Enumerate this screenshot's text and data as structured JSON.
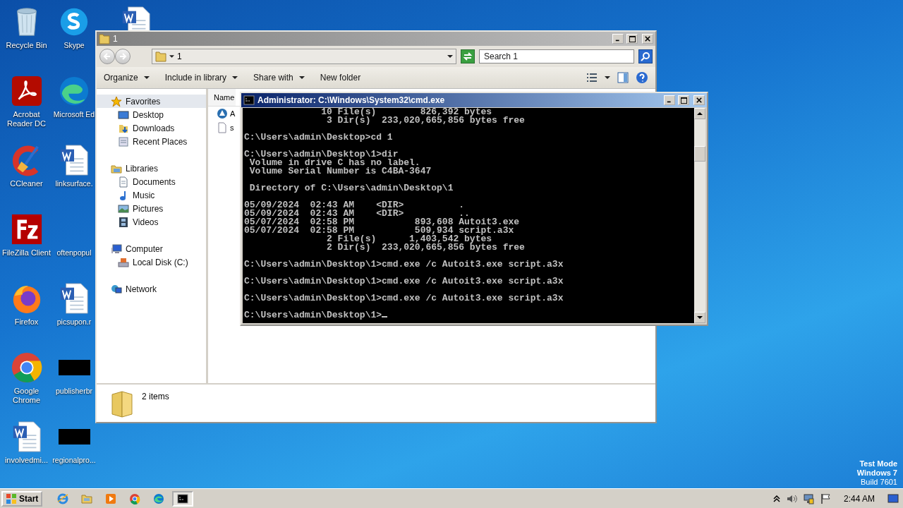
{
  "desktop": {
    "columns": [
      [
        {
          "label": "Recycle Bin",
          "kind": "recycle"
        },
        {
          "label": "Acrobat Reader DC",
          "kind": "acrobat"
        },
        {
          "label": "CCleaner",
          "kind": "ccleaner"
        },
        {
          "label": "FileZilla Client",
          "kind": "filezilla"
        },
        {
          "label": "Firefox",
          "kind": "firefox"
        },
        {
          "label": "Google Chrome",
          "kind": "chrome"
        },
        {
          "label": "involvedmi...",
          "kind": "word"
        }
      ],
      [
        {
          "label": "Skype",
          "kind": "skype"
        },
        {
          "label": "Microsoft Ed",
          "kind": "edge"
        },
        {
          "label": "linksurface.",
          "kind": "word"
        },
        {
          "label": "oftenpopul",
          "kind": "none"
        },
        {
          "label": "picsupon.r",
          "kind": "word"
        },
        {
          "label": "publisherbr",
          "kind": "blank"
        },
        {
          "label": "regionalpro...",
          "kind": "blank"
        }
      ],
      [
        {
          "kind": "word"
        }
      ]
    ],
    "os_notice": [
      "Test Mode",
      "Windows 7",
      "Build 7601"
    ]
  },
  "explorer": {
    "title": "1",
    "address": "1",
    "search": {
      "placeholder": "Search 1"
    },
    "toolbar": [
      {
        "label": "Organize",
        "dropdown": true
      },
      {
        "label": "Include in library",
        "dropdown": true
      },
      {
        "label": "Share with",
        "dropdown": true
      },
      {
        "label": "New folder",
        "dropdown": false
      }
    ],
    "nav": [
      {
        "label": "Favorites",
        "kind": "star",
        "selected": true,
        "children": [
          {
            "label": "Desktop",
            "kind": "desktop",
            "selected": false
          },
          {
            "label": "Downloads",
            "kind": "downloads",
            "selected": false
          },
          {
            "label": "Recent Places",
            "kind": "recent",
            "selected": false
          }
        ]
      },
      {
        "label": "Libraries",
        "kind": "libraries",
        "selected": false,
        "children": [
          {
            "label": "Documents",
            "kind": "documents",
            "selected": false
          },
          {
            "label": "Music",
            "kind": "music",
            "selected": false
          },
          {
            "label": "Pictures",
            "kind": "pictures",
            "selected": false
          },
          {
            "label": "Videos",
            "kind": "videos",
            "selected": false
          }
        ]
      },
      {
        "label": "Computer",
        "kind": "computer",
        "selected": false,
        "children": [
          {
            "label": "Local Disk (C:)",
            "kind": "disk",
            "selected": false
          }
        ]
      },
      {
        "label": "Network",
        "kind": "network",
        "selected": false
      }
    ],
    "columns": [
      "Name"
    ],
    "files": [
      {
        "name": "A",
        "kind": "autoit"
      },
      {
        "name": "s",
        "kind": "file"
      }
    ],
    "status": "2 items"
  },
  "cmd": {
    "title": "Administrator: C:\\Windows\\System32\\cmd.exe",
    "blocks": [
      [
        "              10 File(s)        826,392 bytes",
        "               3 Dir(s)  233,020,665,856 bytes free"
      ],
      [
        "C:\\Users\\admin\\Desktop>cd 1"
      ],
      [
        "C:\\Users\\admin\\Desktop\\1>dir",
        " Volume in drive C has no label.",
        " Volume Serial Number is C4BA-3647"
      ],
      [
        " Directory of C:\\Users\\admin\\Desktop\\1"
      ],
      [
        "05/09/2024  02:43 AM    <DIR>          .",
        "05/09/2024  02:43 AM    <DIR>          ..",
        "05/07/2024  02:58 PM           893,608 Autoit3.exe",
        "05/07/2024  02:58 PM           509,934 script.a3x",
        "               2 File(s)      1,403,542 bytes",
        "               2 Dir(s)  233,020,665,856 bytes free"
      ],
      [
        "C:\\Users\\admin\\Desktop\\1>cmd.exe /c Autoit3.exe script.a3x"
      ],
      [
        "C:\\Users\\admin\\Desktop\\1>cmd.exe /c Autoit3.exe script.a3x"
      ],
      [
        "C:\\Users\\admin\\Desktop\\1>cmd.exe /c Autoit3.exe script.a3x"
      ],
      [
        "C:\\Users\\admin\\Desktop\\1>"
      ]
    ]
  },
  "taskbar": {
    "start": "Start",
    "apps": [
      {
        "kind": "ie",
        "selected": false
      },
      {
        "kind": "explorer",
        "selected": false
      },
      {
        "kind": "media",
        "selected": false
      },
      {
        "kind": "chrome",
        "selected": false
      },
      {
        "kind": "edge",
        "selected": false
      },
      {
        "kind": "cmd",
        "selected": true
      }
    ],
    "clock": "2:44 AM"
  }
}
